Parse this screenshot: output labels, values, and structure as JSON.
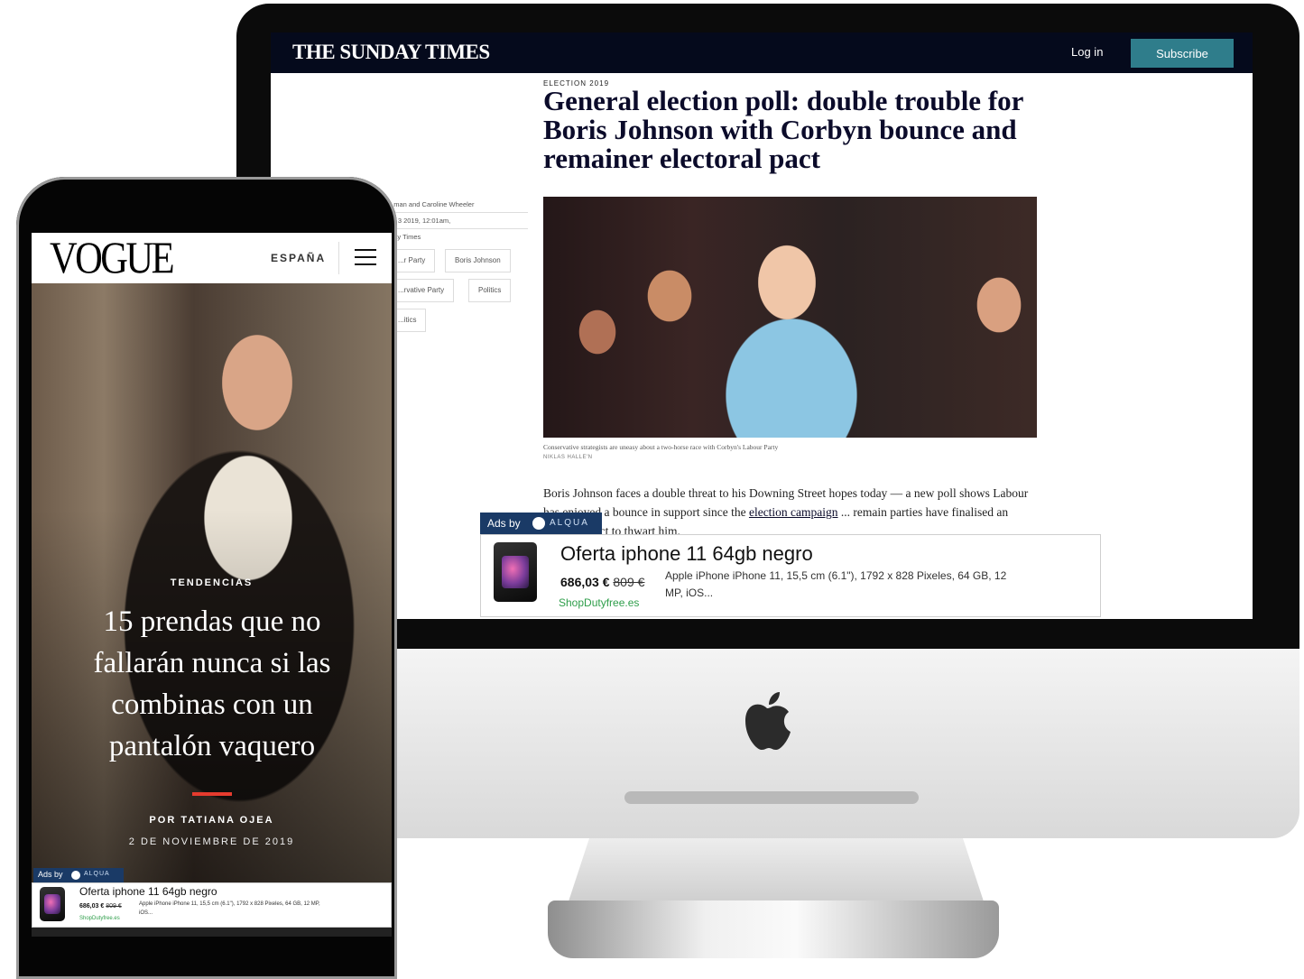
{
  "desktop": {
    "header": {
      "logo": "THE SUNDAY TIMES",
      "login": "Log in",
      "subscribe": "Subscribe"
    },
    "article": {
      "kicker": "ELECTION 2019",
      "headline": "General election poll: double trouble for Boris Johnson with Corbyn bounce and remainer electoral pact",
      "byline": "...man and Caroline Wheeler",
      "date": "...r 3 2019, 12:01am,",
      "publication": "...ay Times",
      "tags": [
        "...r Party",
        "Boris Johnson",
        "...rvative Party",
        "Politics",
        "...itics"
      ],
      "caption": "Conservative strategists are uneasy about a two-horse race with Corbyn's Labour Party",
      "photo_credit": "NIKLAS HALLE'N",
      "body_1": "Boris Johnson faces a double threat to his Downing Street hopes today — a new poll shows Labour has enjoyed a bounce in support since the",
      "body_link": "election campaign",
      "body_2": "... remain parties have finalised an electoral pact to thwart him."
    },
    "ad": {
      "label_prefix": "Ads by",
      "label_brand": "ALQUA",
      "title": "Oferta iphone 11 64gb negro",
      "price": "686,03 €",
      "old_price": "809 €",
      "description": "Apple iPhone iPhone 11, 15,5 cm (6.1\"), 1792 x 828 Pixeles, 64 GB, 12 MP, iOS...",
      "shop": "ShopDutyfree.es"
    }
  },
  "mobile": {
    "header": {
      "logo": "VOGUE",
      "country": "ESPAÑA"
    },
    "hero": {
      "section": "TENDENCIAS",
      "title": "15 prendas que no fallarán nunca si las combinas con un pantalón vaquero",
      "author": "POR TATIANA OJEA",
      "date": "2 DE NOVIEMBRE DE 2019"
    },
    "ad": {
      "label_prefix": "Ads by",
      "label_brand": "ALQUA",
      "title": "Oferta iphone 11 64gb negro",
      "price": "686,03 €",
      "old_price": "809 €",
      "description": "Apple iPhone iPhone 11, 15,5 cm (6.1\"), 1792 x 828 Pixeles, 64 GB, 12 MP, iOS...",
      "shop": "ShopDutyfree.es"
    }
  },
  "colors": {
    "times_header": "#050a1c",
    "times_subscribe": "#2f7d8b",
    "vogue_accent": "#e63b2e",
    "ad_label_bg": "#1a3a66",
    "ad_shop": "#2e9e4a"
  },
  "icons": [
    "apple-logo-icon",
    "hamburger-menu-icon",
    "alqua-logo-icon"
  ]
}
